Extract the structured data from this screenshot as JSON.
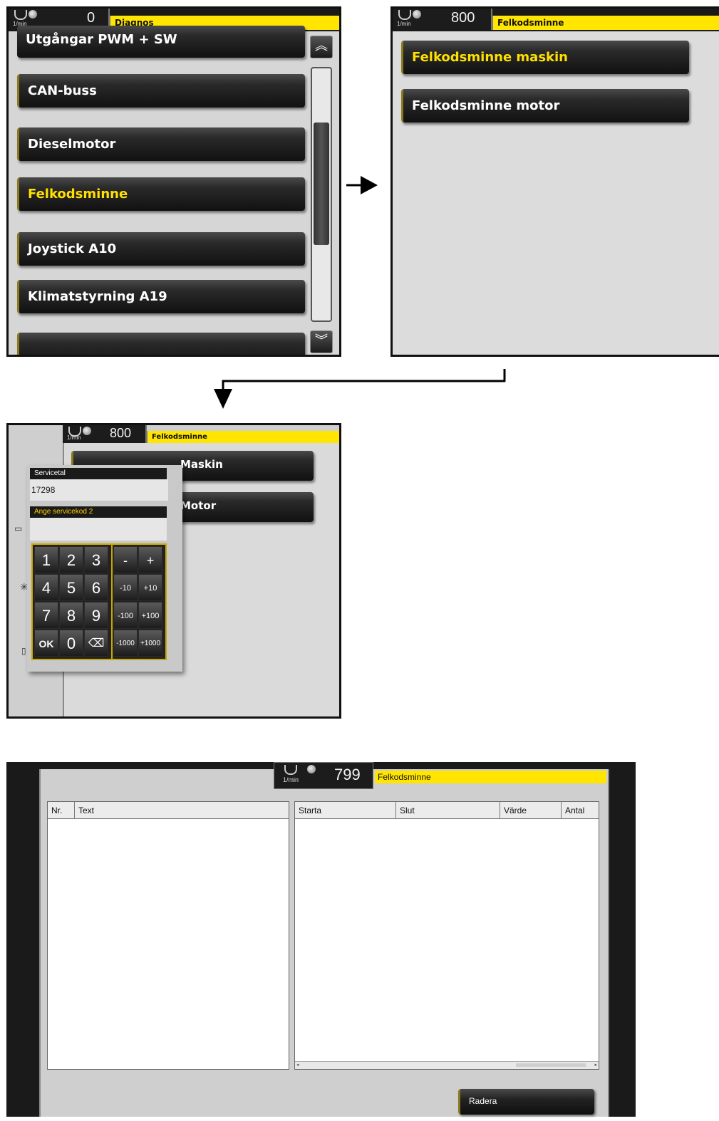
{
  "panel1": {
    "rpm_unit": "1/min",
    "rpm_value": "0",
    "title": "Diagnos",
    "menu_items": [
      "Utgångar PWM + SW",
      "CAN-buss",
      "Dieselmotor",
      "Felkodsminne",
      "Joystick A10",
      "Klimatstyrning A19",
      ""
    ],
    "selected_item": "Felkodsminne",
    "scroll_up_icon": "double-chevron-up-icon",
    "scroll_down_icon": "double-chevron-down-icon"
  },
  "panel2": {
    "rpm_unit": "1/min",
    "rpm_value": "800",
    "title": "Felkodsminne",
    "menu_items": [
      "Felkodsminne maskin",
      "Felkodsminne motor"
    ],
    "selected_item": "Felkodsminne maskin"
  },
  "panel3": {
    "rpm_unit": "1/min",
    "rpm_value": "800",
    "title": "Felkodsminne",
    "menu_items": [
      "Maskin",
      "Motor"
    ],
    "dialog": {
      "label1": "Servicetal",
      "value1": "17298",
      "label2": "Ange servicekod 2",
      "value2": ""
    },
    "keypad": {
      "digits": [
        "1",
        "2",
        "3",
        "4",
        "5",
        "6",
        "7",
        "8",
        "9",
        "OK",
        "0",
        "⌫"
      ],
      "adjust": [
        "-",
        "+",
        "-10",
        "+10",
        "-100",
        "+100",
        "-1000",
        "+1000"
      ]
    }
  },
  "panel4": {
    "rpm_unit": "1/min",
    "rpm_value": "799",
    "title": "Felkodsminne",
    "left_table_headers": [
      "Nr.",
      "Text"
    ],
    "right_table_headers": [
      "Starta",
      "Slut",
      "Värde",
      "Antal"
    ],
    "delete_button": "Radera"
  },
  "colors": {
    "accent_yellow": "#ffe500",
    "dark_button": "#1c1c1c",
    "panel_bg": "#dedede"
  }
}
